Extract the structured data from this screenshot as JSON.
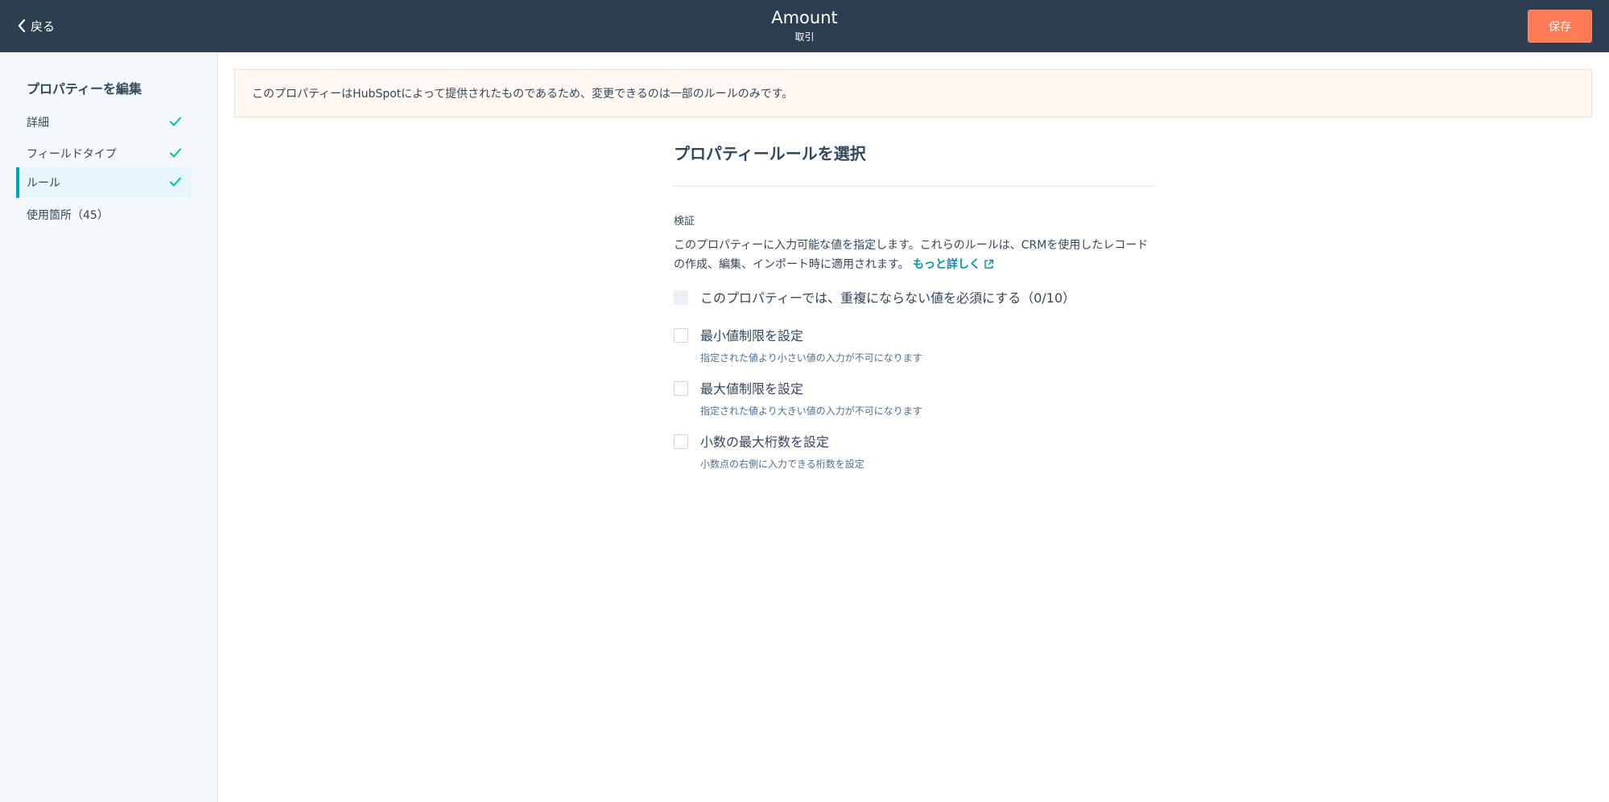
{
  "header": {
    "back_label": "戻る",
    "title": "Amount",
    "subtitle": "取引",
    "save_label": "保存"
  },
  "sidebar": {
    "heading": "プロパティーを編集",
    "items": [
      {
        "label": "詳細",
        "completed": true,
        "active": false
      },
      {
        "label": "フィールドタイプ",
        "completed": true,
        "active": false
      },
      {
        "label": "ルール",
        "completed": true,
        "active": true
      },
      {
        "label": "使用箇所（45）",
        "completed": false,
        "active": false
      }
    ]
  },
  "banner": {
    "text": "このプロパティーはHubSpotによって提供されたものであるため、変更できるのは一部のルールのみです。"
  },
  "rules": {
    "title": "プロパティールールを選択",
    "validation_label": "検証",
    "validation_desc": "このプロパティーに入力可能な値を指定します。これらのルールは、CRMを使用したレコードの作成、編集、インポート時に適用されます。",
    "learn_more": "もっと詳しく",
    "options": [
      {
        "label": "このプロパティーでは、重複にならない値を必須にする（0/10）",
        "help": "",
        "checked": false,
        "disabled": true
      },
      {
        "label": "最小値制限を設定",
        "help": "指定された値より小さい値の入力が不可になります",
        "checked": false,
        "disabled": false
      },
      {
        "label": "最大値制限を設定",
        "help": "指定された値より大きい値の入力が不可になります",
        "checked": false,
        "disabled": false
      },
      {
        "label": "小数の最大桁数を設定",
        "help": "小数点の右側に入力できる桁数を設定",
        "checked": false,
        "disabled": false
      }
    ]
  },
  "colors": {
    "topbar": "#2d3e50",
    "accent": "#ff7a59",
    "teal": "#00a4bd",
    "link": "#0091ae"
  }
}
